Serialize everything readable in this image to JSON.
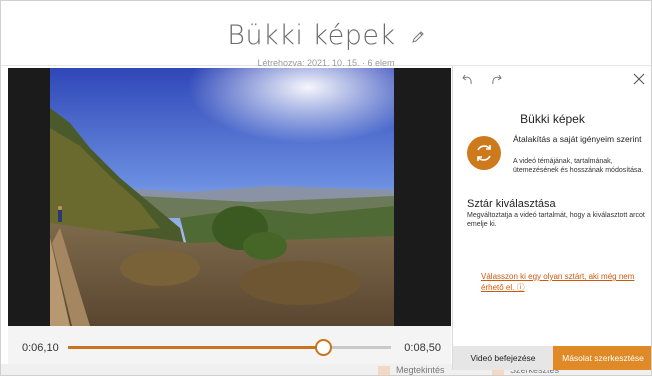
{
  "header": {
    "title": "Bükki képek",
    "created": "Létrehozva: 2021. 10. 15. · 6 elem"
  },
  "player": {
    "start_time": "0:06,10",
    "end_time": "0:08,50",
    "progress": 0.79
  },
  "bottom_bar": {
    "preview_label": "Megtekintés",
    "edit_label": "Szerkesztés"
  },
  "panel": {
    "title": "Bükki képek",
    "convert_heading": "Átalakítás a saját igényeim szerint",
    "convert_desc": "A videó témájának, tartalmának, ütemezésének és hosszának módosítása.",
    "star_heading": "Sztár kiválasztása",
    "star_desc": "Megváltoztatja a videó tartalmát, hogy a kiválasztott arcot emelje ki.",
    "star_link": "Válasszon ki egy olyan sztárt, aki még nem érhető el. ⓘ",
    "finish_button": "Videó befejezése",
    "copy_button": "Másolat szerkesztése"
  },
  "colors": {
    "accent": "#cd7a1d",
    "accent_button": "#df8a27",
    "link": "#cc5a0e"
  },
  "icons": [
    "pencil-icon",
    "undo-icon",
    "redo-icon",
    "close-icon",
    "refresh-icon"
  ]
}
